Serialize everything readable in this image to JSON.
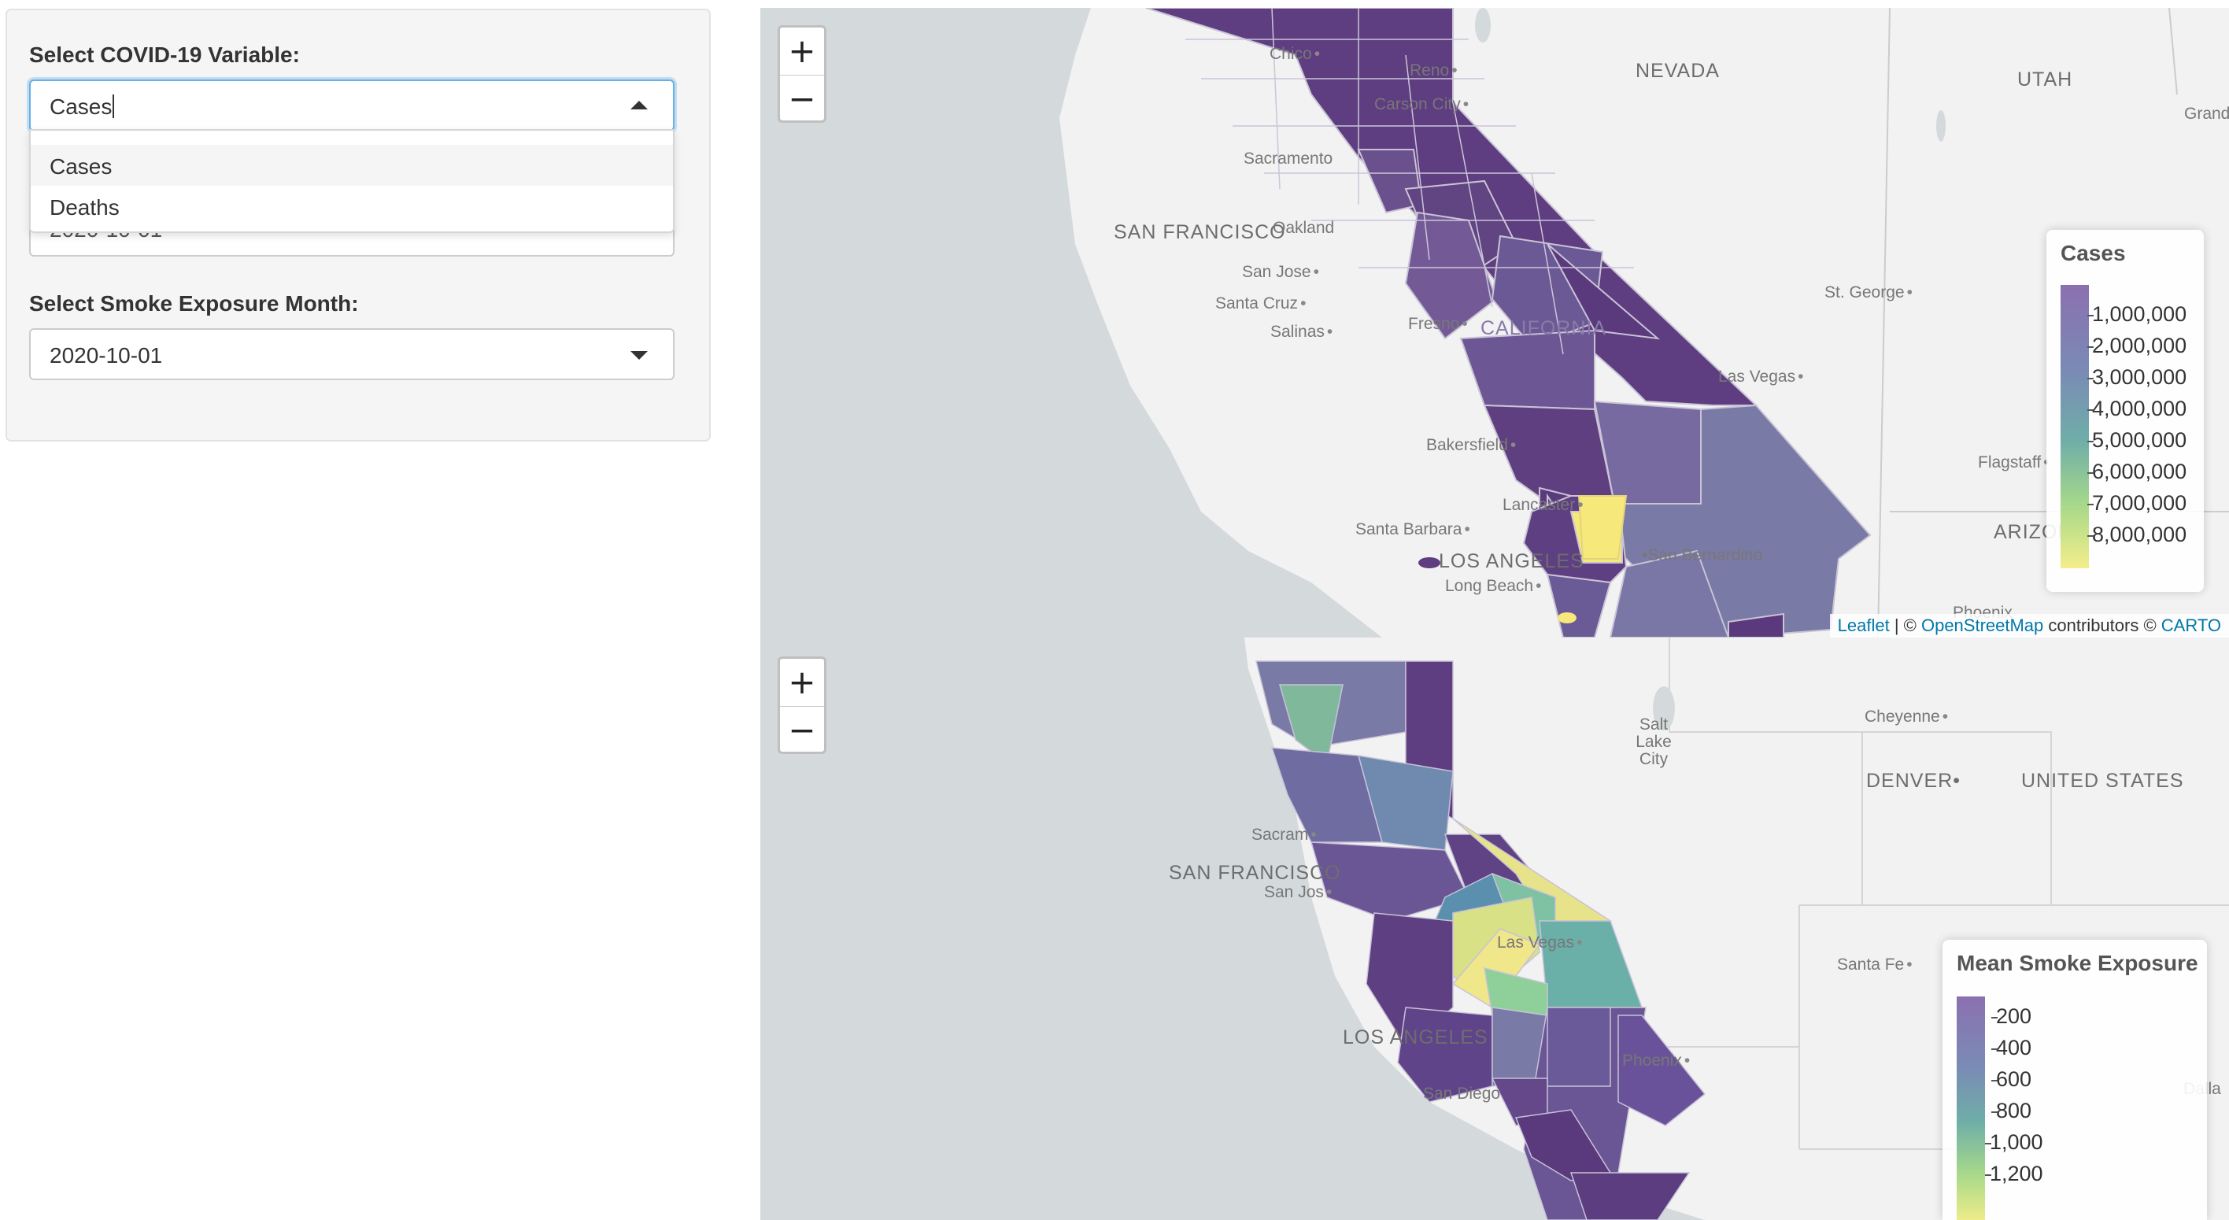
{
  "sidebar": {
    "covid_label": "Select COVID-19 Variable:",
    "covid_value": "Cases",
    "covid_options": [
      "Cases",
      "Deaths"
    ],
    "hidden_value": "2020-10-01",
    "smoke_label": "Select Smoke Exposure Month:",
    "smoke_value": "2020-10-01"
  },
  "colors": {
    "viridis_low": "#440154",
    "viridis_high": "#fde725",
    "water": "#d4dadc",
    "land": "#f2f2f2"
  },
  "map_top": {
    "zoom_in": "+",
    "zoom_out": "−",
    "legend_title": "Cases",
    "legend_ticks": [
      "1,000,000",
      "2,000,000",
      "3,000,000",
      "4,000,000",
      "5,000,000",
      "6,000,000",
      "7,000,000",
      "8,000,000"
    ],
    "attribution": {
      "leaflet": "Leaflet",
      "sep1": " | © ",
      "osm": "OpenStreetMap",
      "mid": " contributors © ",
      "carto": "CARTO"
    },
    "labels": {
      "nevada": "NEVADA",
      "utah": "UTAH",
      "arizona": "ARIZONA",
      "california": "CALIFORNIA",
      "sf": "SAN FRANCISCO",
      "oakland": "Oakland",
      "la": "LOS ANGELES",
      "chico": "Chico",
      "reno": "Reno",
      "carson": "Carson City",
      "sacramento": "Sacramento",
      "sanjose": "San Jose",
      "santacruz": "Santa Cruz",
      "salinas": "Salinas",
      "fresno": "Fresno",
      "bakersfield": "Bakersfield",
      "lancaster": "Lancaster",
      "santabarbara": "Santa Barbara",
      "longbeach": "Long Beach",
      "sanbernardino": "San Bernardino",
      "lasvegas": "Las Vegas",
      "stgeorge": "St. George",
      "flagstaff": "Flagstaff",
      "grandjunction": "Grand Jur",
      "phoenix": "Phoenix"
    }
  },
  "map_bottom": {
    "zoom_in": "+",
    "zoom_out": "−",
    "legend_title": "Mean Smoke Exposure",
    "legend_ticks": [
      "200",
      "400",
      "600",
      "800",
      "1,000",
      "1,200"
    ],
    "labels": {
      "saltlake": "Salt Lake City",
      "cheyenne": "Cheyenne",
      "denver": "DENVER",
      "us": "UNITED STATES",
      "sacramento": "Sacram",
      "sf": "SAN FRANCISCO",
      "sanjose": "San Jos",
      "lasvegas": "Las Vegas",
      "santafe": "Santa Fe",
      "la": "LOS ANGELES",
      "phoenix": "Phoenix",
      "sandiego": "San Diego",
      "dalla": "Dalla"
    }
  }
}
